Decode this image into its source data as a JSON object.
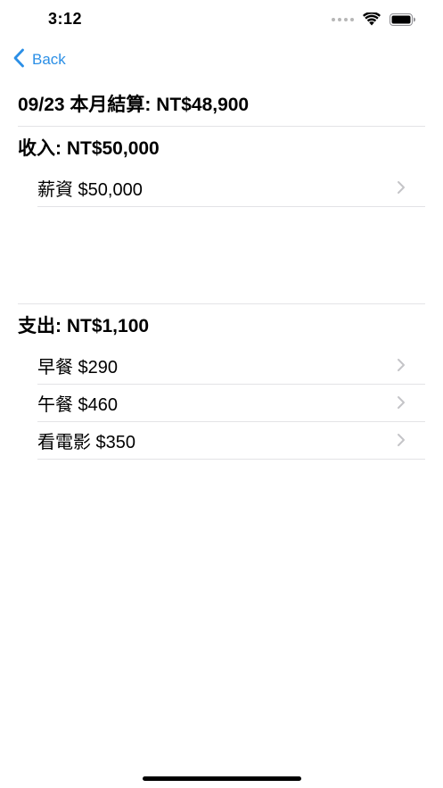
{
  "status_bar": {
    "time": "3:12"
  },
  "nav": {
    "back_label": "Back"
  },
  "summary": {
    "title": "09/23 本月結算: NT$48,900"
  },
  "income": {
    "title": "收入: NT$50,000",
    "items": [
      {
        "label": "薪資  $50,000"
      }
    ]
  },
  "expense": {
    "title": "支出: NT$1,100",
    "items": [
      {
        "label": "早餐  $290"
      },
      {
        "label": "午餐  $460"
      },
      {
        "label": "看電影  $350"
      }
    ]
  },
  "colors": {
    "accent": "#2b8fe6",
    "separator": "#e3e3e6",
    "chevron": "#c4c4c7"
  }
}
